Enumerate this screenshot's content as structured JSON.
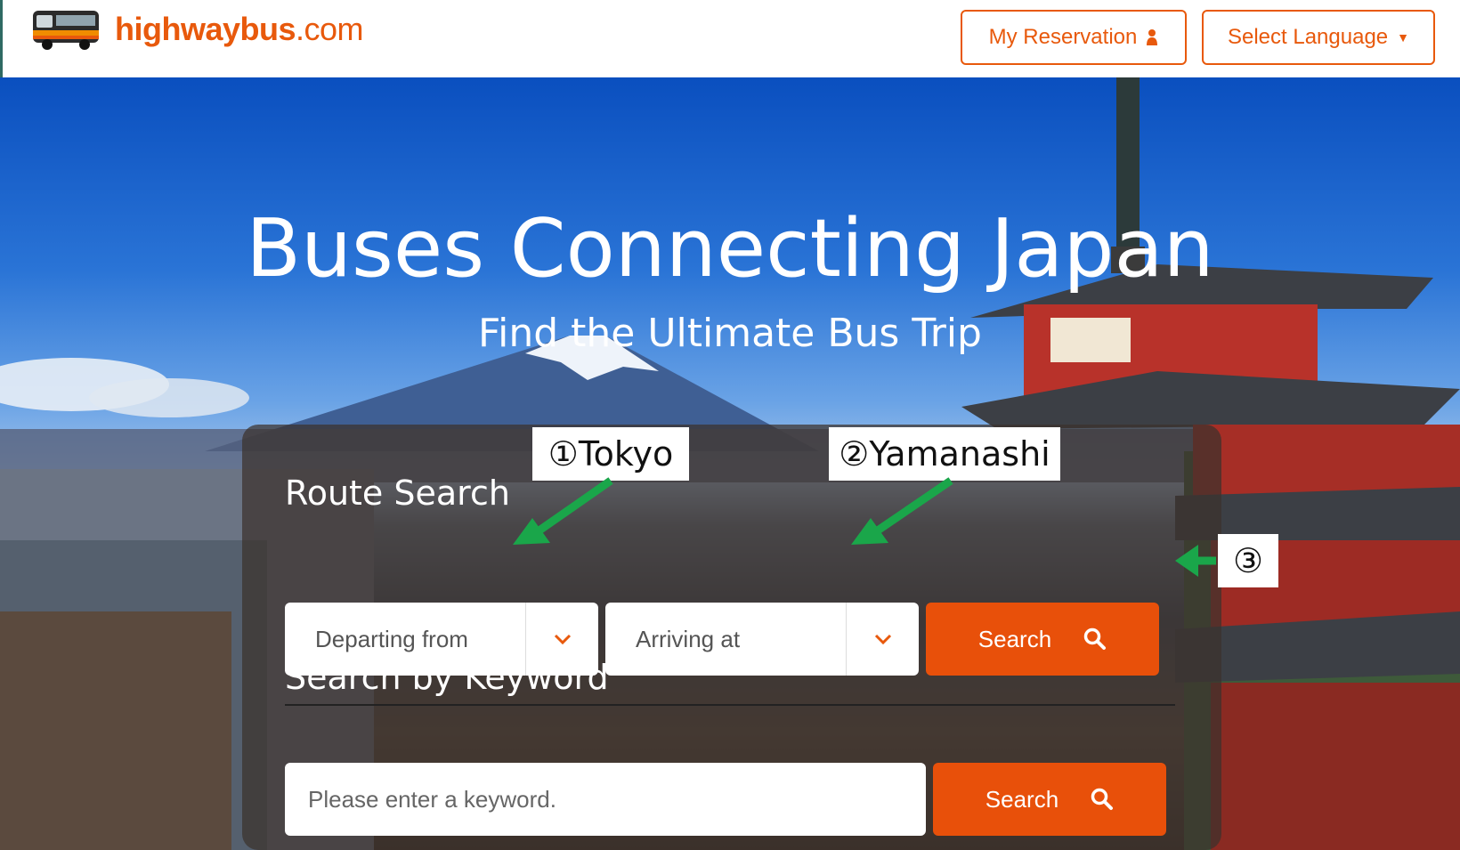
{
  "header": {
    "logo_icon": "bus-icon",
    "logo_bold": "highwaybus",
    "logo_suffix": ".com",
    "my_reservation_label": "My Reservation",
    "select_language_label": "Select Language",
    "person_icon": "person-icon",
    "caret_icon": "caret-down-icon"
  },
  "hero": {
    "title": "Buses Connecting Japan",
    "subtitle": "Find the Ultimate Bus Trip"
  },
  "route_search": {
    "title": "Route Search",
    "departing_placeholder": "Departing from",
    "arriving_placeholder": "Arriving at",
    "search_label": "Search",
    "search_icon": "search-icon",
    "chevron_icon": "chevron-down-icon"
  },
  "keyword_search": {
    "title": "Search by Keyword",
    "placeholder": "Please enter a keyword.",
    "search_label": "Search"
  },
  "annotations": {
    "step1": "①Tokyo",
    "step2": "②Yamanashi",
    "step3": "③"
  },
  "colors": {
    "brand_orange": "#e8590c",
    "button_orange": "#e8500a",
    "arrow_green": "#1aa64a"
  }
}
